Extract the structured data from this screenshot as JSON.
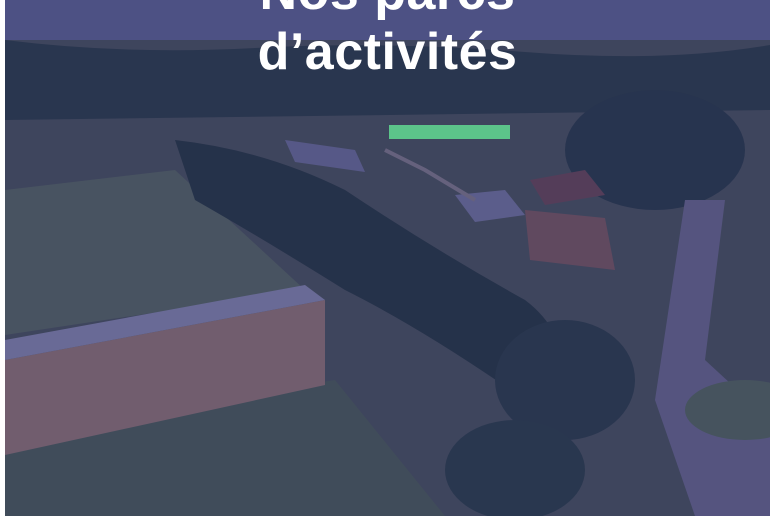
{
  "hero": {
    "title_line1": "Nos parcs",
    "title_line2": "d’activités",
    "accent_color": "#5cc48a",
    "overlay_color": "#28266e"
  }
}
